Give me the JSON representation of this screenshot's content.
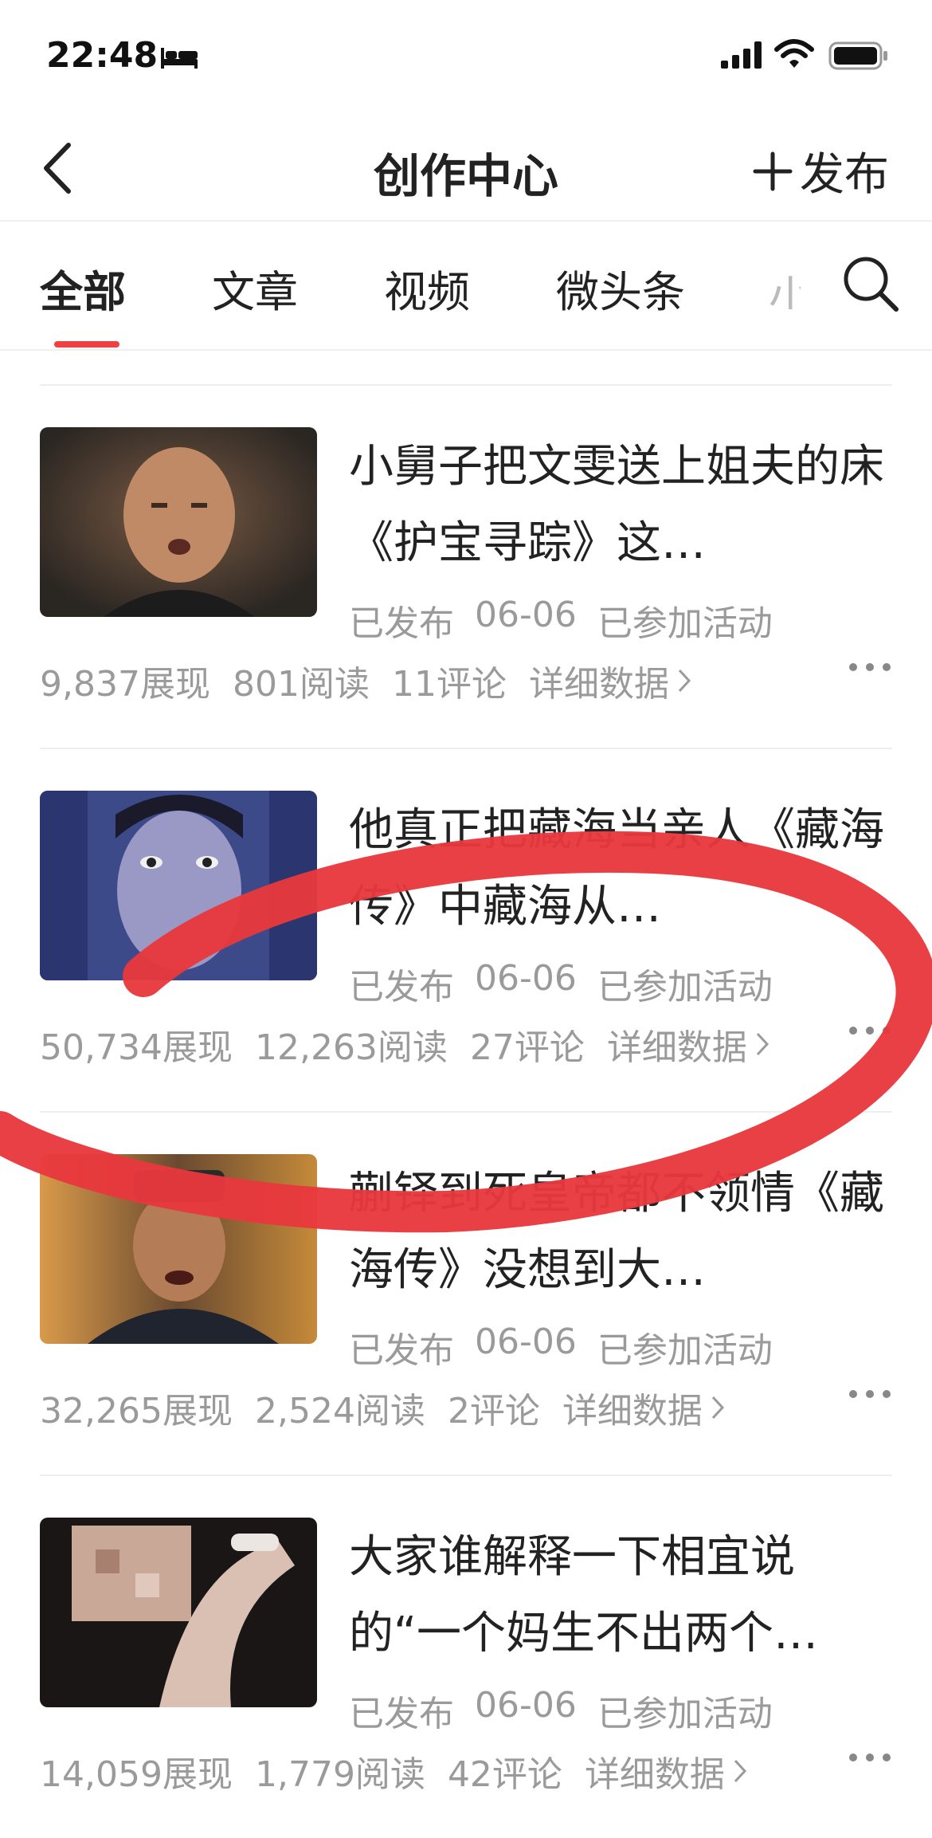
{
  "status": {
    "time": "22:48"
  },
  "nav": {
    "title": "创作中心",
    "publish_label": "发布"
  },
  "tabs": [
    {
      "label": "全部"
    },
    {
      "label": "文章"
    },
    {
      "label": "视频"
    },
    {
      "label": "微头条"
    },
    {
      "label": "小"
    }
  ],
  "items": [
    {
      "title": "小舅子把文雯送上姐夫的床《护宝寻踪》这…",
      "status": "已发布",
      "date": "06-06",
      "activity": "已参加活动",
      "impressions": "9,837展现",
      "reads": "801阅读",
      "comments": "11评论",
      "detail": "详细数据"
    },
    {
      "title": "他真正把藏海当亲人《藏海传》中藏海从…",
      "status": "已发布",
      "date": "06-06",
      "activity": "已参加活动",
      "impressions": "50,734展现",
      "reads": "12,263阅读",
      "comments": "27评论",
      "detail": "详细数据"
    },
    {
      "title": "蒯铎到死皇帝都不领情《藏海传》没想到大…",
      "status": "已发布",
      "date": "06-06",
      "activity": "已参加活动",
      "impressions": "32,265展现",
      "reads": "2,524阅读",
      "comments": "2评论",
      "detail": "详细数据"
    },
    {
      "title": "大家谁解释一下相宜说的“一个妈生不出两个…",
      "status": "已发布",
      "date": "06-06",
      "activity": "已参加活动",
      "impressions": "14,059展现",
      "reads": "1,779阅读",
      "comments": "42评论",
      "detail": "详细数据"
    }
  ],
  "colors": {
    "accent": "#f04142",
    "annotation": "#e8383d",
    "meta_text": "#9a9a9a"
  },
  "icons": [
    "back-icon",
    "plus-icon",
    "search-icon",
    "chevron-right-icon",
    "more-icon",
    "bed-icon",
    "signal-icon",
    "wifi-icon",
    "battery-icon"
  ]
}
